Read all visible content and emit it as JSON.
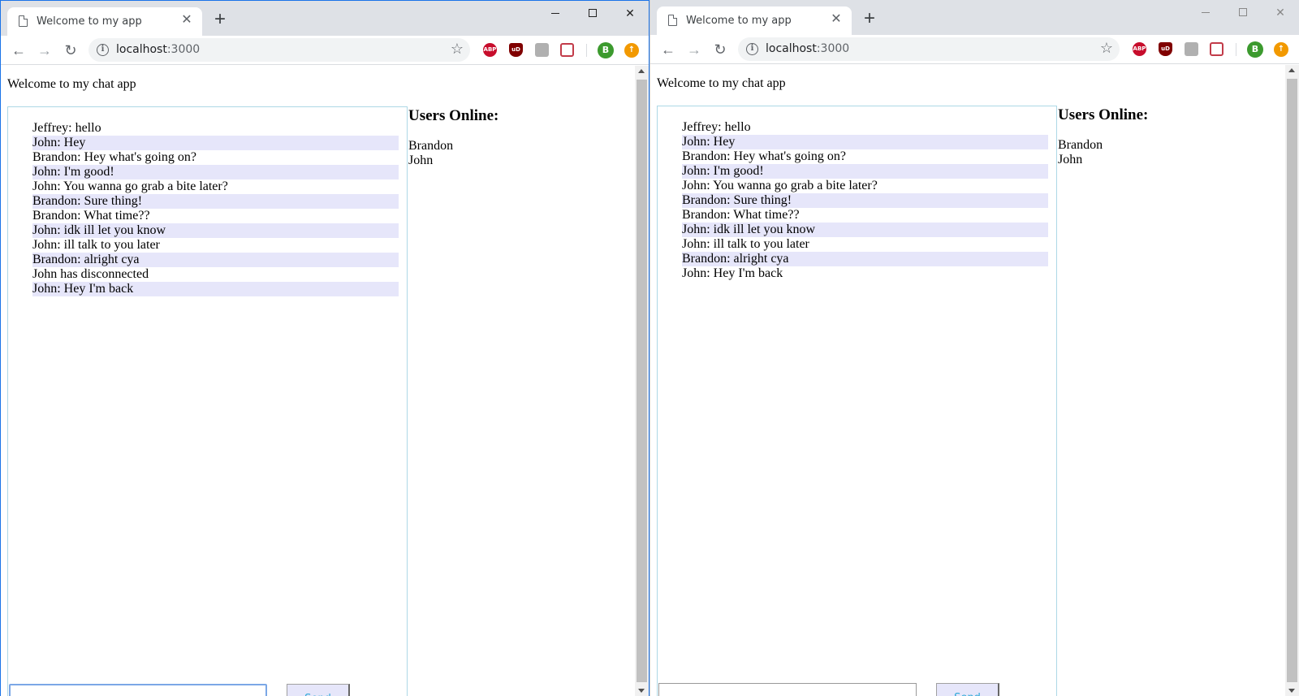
{
  "browser": {
    "tab_title": "Welcome to my app",
    "tab_close": "✕",
    "new_tab": "+",
    "url_host": "localhost",
    "url_port": ":3000",
    "avatar_letter": "B",
    "ext_abp": "ABP",
    "ext_ublock": "uD",
    "close_glyph": "✕"
  },
  "page": {
    "welcome": "Welcome to my chat app",
    "users_heading": "Users Online:",
    "users": [
      "Brandon",
      "John"
    ],
    "send_label": "Send"
  },
  "left_window": {
    "messages": [
      "Jeffrey: hello",
      "John: Hey",
      "Brandon: Hey what's going on?",
      "John: I'm good!",
      "John: You wanna go grab a bite later?",
      "Brandon: Sure thing!",
      "Brandon: What time??",
      "John: idk ill let you know",
      "John: ill talk to you later",
      "Brandon: alright cya",
      "John has disconnected",
      "John: Hey I'm back"
    ],
    "input_value": ""
  },
  "right_window": {
    "messages": [
      "Jeffrey: hello",
      "John: Hey",
      "Brandon: Hey what's going on?",
      "John: I'm good!",
      "John: You wanna go grab a bite later?",
      "Brandon: Sure thing!",
      "Brandon: What time??",
      "John: idk ill let you know",
      "John: ill talk to you later",
      "Brandon: alright cya",
      "John: Hey I'm back"
    ],
    "input_value": ""
  },
  "colors": {
    "alt_row": "#e6e6fa",
    "chat_border": "#add8e6",
    "send_text": "#2ca8d8"
  },
  "icons": [
    "page-icon",
    "back-arrow-icon",
    "forward-arrow-icon",
    "reload-icon",
    "info-icon",
    "star-icon",
    "adblock-plus-icon",
    "ublock-origin-icon",
    "pocket-icon",
    "profile-avatar-icon",
    "update-icon"
  ]
}
